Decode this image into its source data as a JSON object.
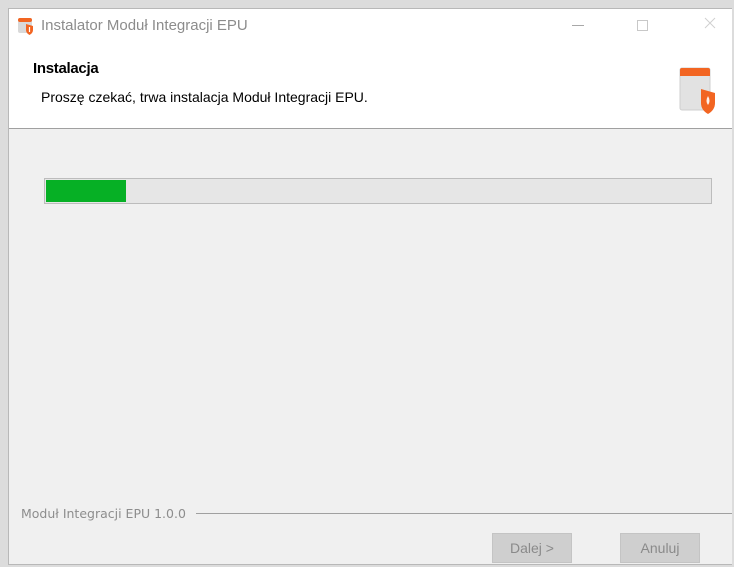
{
  "window": {
    "title": "Instalator Moduł Integracji EPU",
    "icon": "installer-shield-icon",
    "controls": {
      "minimize_icon": "minimize-icon",
      "maximize_icon": "maximize-icon",
      "close_icon": "close-icon"
    }
  },
  "header": {
    "title": "Instalacja",
    "subtitle": "Proszę czekać, trwa instalacja Moduł Integracji EPU.",
    "icon": "installer-box-icon"
  },
  "progress": {
    "value_percent": 12,
    "color": "#06b025"
  },
  "footer": {
    "version_label": "Moduł Integracji EPU 1.0.0",
    "next_label": "Dalej >",
    "cancel_label": "Anuluj"
  },
  "colors": {
    "accent_orange": "#f26522",
    "progress_green": "#06b025"
  }
}
